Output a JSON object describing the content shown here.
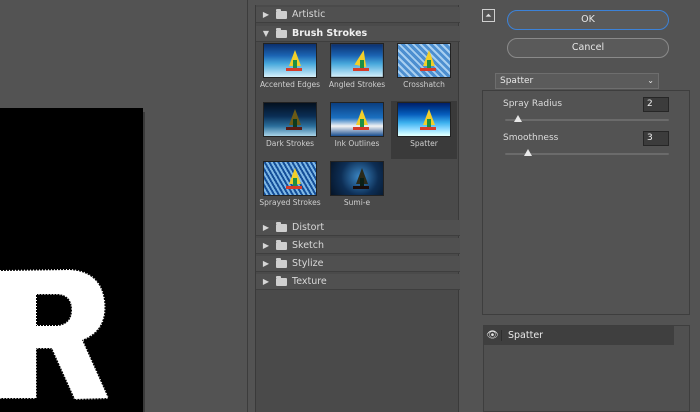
{
  "gallery": {
    "categories_top": [
      {
        "label": "Artistic",
        "open": false
      }
    ],
    "brush_strokes": {
      "label": "Brush Strokes",
      "filters": [
        {
          "label": "Accented Edges",
          "style": "accent"
        },
        {
          "label": "Angled Strokes",
          "style": "angled"
        },
        {
          "label": "Crosshatch",
          "style": "cross"
        },
        {
          "label": "Dark Strokes",
          "style": "dark"
        },
        {
          "label": "Ink Outlines",
          "style": "ink"
        },
        {
          "label": "Spatter",
          "style": "spatter",
          "selected": true
        },
        {
          "label": "Sprayed Strokes",
          "style": "spray"
        },
        {
          "label": "Sumi-e",
          "style": "sumi"
        }
      ]
    },
    "categories_bottom": [
      {
        "label": "Distort"
      },
      {
        "label": "Sketch"
      },
      {
        "label": "Stylize"
      },
      {
        "label": "Texture"
      }
    ]
  },
  "buttons": {
    "ok": "OK",
    "cancel": "Cancel",
    "collapse_icon": "collapse-up-icon"
  },
  "settings": {
    "filter_selected": "Spatter",
    "params": [
      {
        "label": "Spray Radius",
        "value": "2",
        "min": 0,
        "max": 25
      },
      {
        "label": "Smoothness",
        "value": "3",
        "min": 1,
        "max": 15
      }
    ]
  },
  "layers": {
    "items": [
      {
        "name": "Spatter",
        "visible": true
      }
    ]
  },
  "colors": {
    "ok_border": "#3c82d8",
    "panel_bg": "#535353",
    "canvas": "#000000"
  }
}
